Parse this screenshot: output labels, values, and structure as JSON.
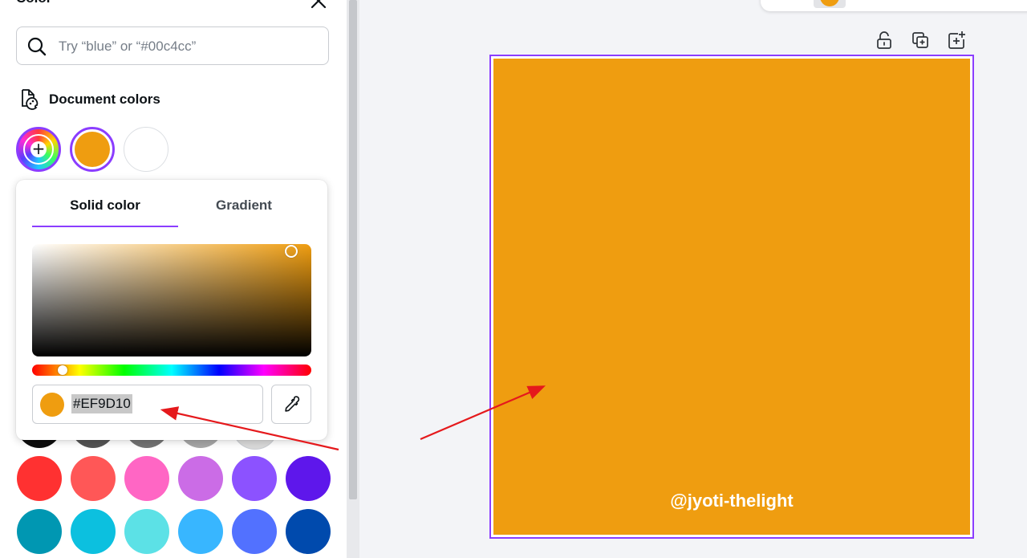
{
  "panel": {
    "title": "Color",
    "search": {
      "placeholder": "Try “blue” or “#00c4cc”"
    },
    "document_colors": {
      "label": "Document colors",
      "colors": [
        "#EF9D10",
        "#FFFFFF"
      ]
    },
    "palette": {
      "row_partial": [
        "#0d0d0d",
        "#545454",
        "#737373",
        "#a6a6a6",
        "#d9d9d9"
      ],
      "row_2": [
        "#ff3131",
        "#ff5757",
        "#ff66c4",
        "#cb6ce6",
        "#8c52ff",
        "#5e17eb"
      ],
      "row_3": [
        "#0097b2",
        "#0cc0df",
        "#5ce1e6",
        "#38b6ff",
        "#5271ff",
        "#004aad"
      ]
    }
  },
  "color_picker": {
    "tabs": [
      {
        "label": "Solid color",
        "active": true
      },
      {
        "label": "Gradient",
        "active": false
      }
    ],
    "hex_value": "#EF9D10",
    "current_color": "#EF9D10",
    "hue_position_fraction": 0.11
  },
  "canvas": {
    "page_background": "#EF9D10",
    "watermark": "@jyoti-thelight",
    "selection_color": "#8b3dff",
    "annotation_arrow_color": "#e5191c"
  }
}
